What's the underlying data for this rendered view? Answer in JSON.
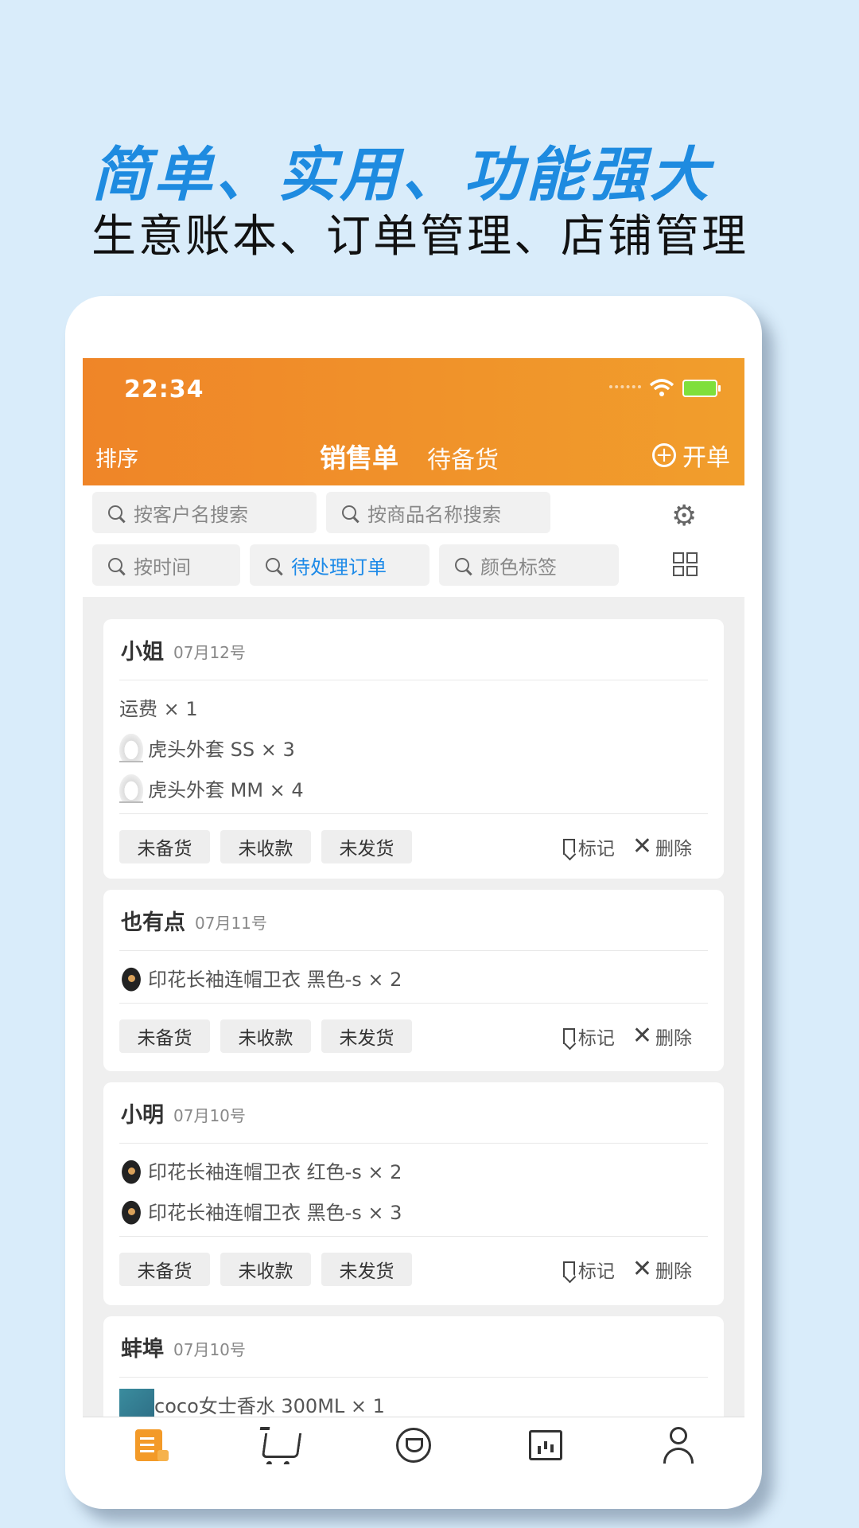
{
  "promo": {
    "headline": "简单、实用、功能强大",
    "subline": "生意账本、订单管理、店铺管理"
  },
  "status_bar": {
    "time": "22:34"
  },
  "header": {
    "sort_label": "排序",
    "tabs": [
      {
        "label": "销售单",
        "active": true
      },
      {
        "label": "待备货",
        "active": false
      }
    ],
    "new_order_label": "开单"
  },
  "filters": {
    "customer_search": "按客户名搜索",
    "product_search": "按商品名称搜索",
    "time": "按时间",
    "pending": "待处理订单",
    "color_tag": "颜色标签"
  },
  "orders": [
    {
      "customer": "小姐",
      "date": "07月12号",
      "items": [
        {
          "text": "运费 × 1",
          "thumb": "none"
        },
        {
          "text": "虎头外套 SS × 3",
          "thumb": "white-jacket"
        },
        {
          "text": "虎头外套 MM × 4",
          "thumb": "white-jacket"
        }
      ]
    },
    {
      "customer": "也有点",
      "date": "07月11号",
      "items": [
        {
          "text": "印花长袖连帽卫衣 黑色-s × 2",
          "thumb": "black-hoodie"
        }
      ]
    },
    {
      "customer": "小明",
      "date": "07月10号",
      "items": [
        {
          "text": "印花长袖连帽卫衣 红色-s × 2",
          "thumb": "black-hoodie"
        },
        {
          "text": "印花长袖连帽卫衣 黑色-s × 3",
          "thumb": "black-hoodie"
        }
      ]
    },
    {
      "customer": "蚌埠",
      "date": "07月10号",
      "items": [
        {
          "text": "coco女士香水 300ML × 1",
          "thumb": "perfume"
        }
      ]
    }
  ],
  "status_chips": [
    "未备货",
    "未收款",
    "未发货"
  ],
  "actions": {
    "mark": "标记",
    "delete": "删除"
  },
  "tabbar": [
    {
      "label": "订单",
      "icon": "order-icon",
      "active": true
    },
    {
      "label": "商品",
      "icon": "cart-icon",
      "active": false
    },
    {
      "label": "客户",
      "icon": "customer-icon",
      "active": false
    },
    {
      "label": "统计",
      "icon": "stats-icon",
      "active": false
    },
    {
      "label": "我的",
      "icon": "profile-icon",
      "active": false
    }
  ],
  "colors": {
    "accent": "#f0861f",
    "link": "#1d8ae8",
    "headline": "#1e8be0",
    "background": "#d9ecfa"
  }
}
